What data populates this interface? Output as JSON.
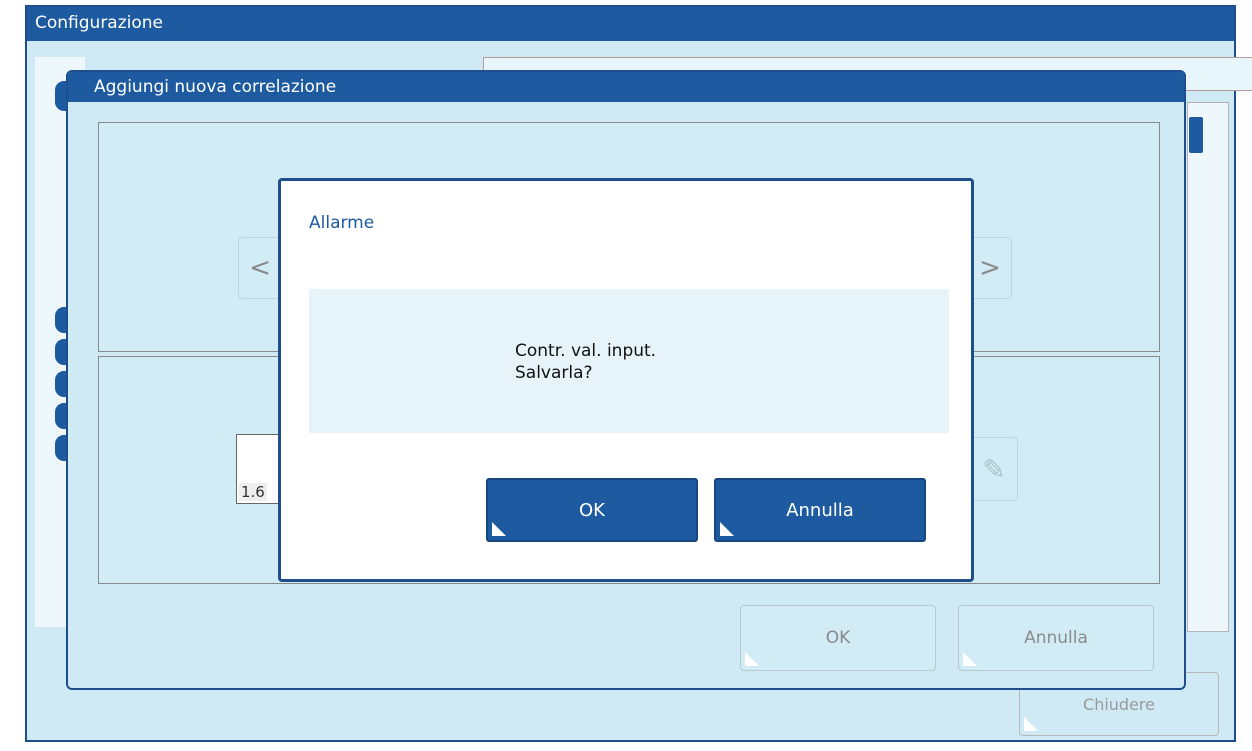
{
  "config_window": {
    "title": "Configurazione",
    "close_button_label": "Chiudere"
  },
  "correlation_window": {
    "title": "Aggiungi nuova correlazione",
    "prev_glyph": "<",
    "next_glyph": ">",
    "value_text": "1.6",
    "edit_icon": "pencil-icon",
    "ok_label": "OK",
    "cancel_label": "Annulla"
  },
  "alarm_dialog": {
    "title": "Allarme",
    "message_line_1": "Contr. val. input.",
    "message_line_2": "Salvarla?",
    "ok_label": "OK",
    "cancel_label": "Annulla"
  },
  "colors": {
    "titlebar_blue": "#1e5aa0",
    "window_background": "#cfeaf4",
    "dialog_background": "#ffffff"
  }
}
